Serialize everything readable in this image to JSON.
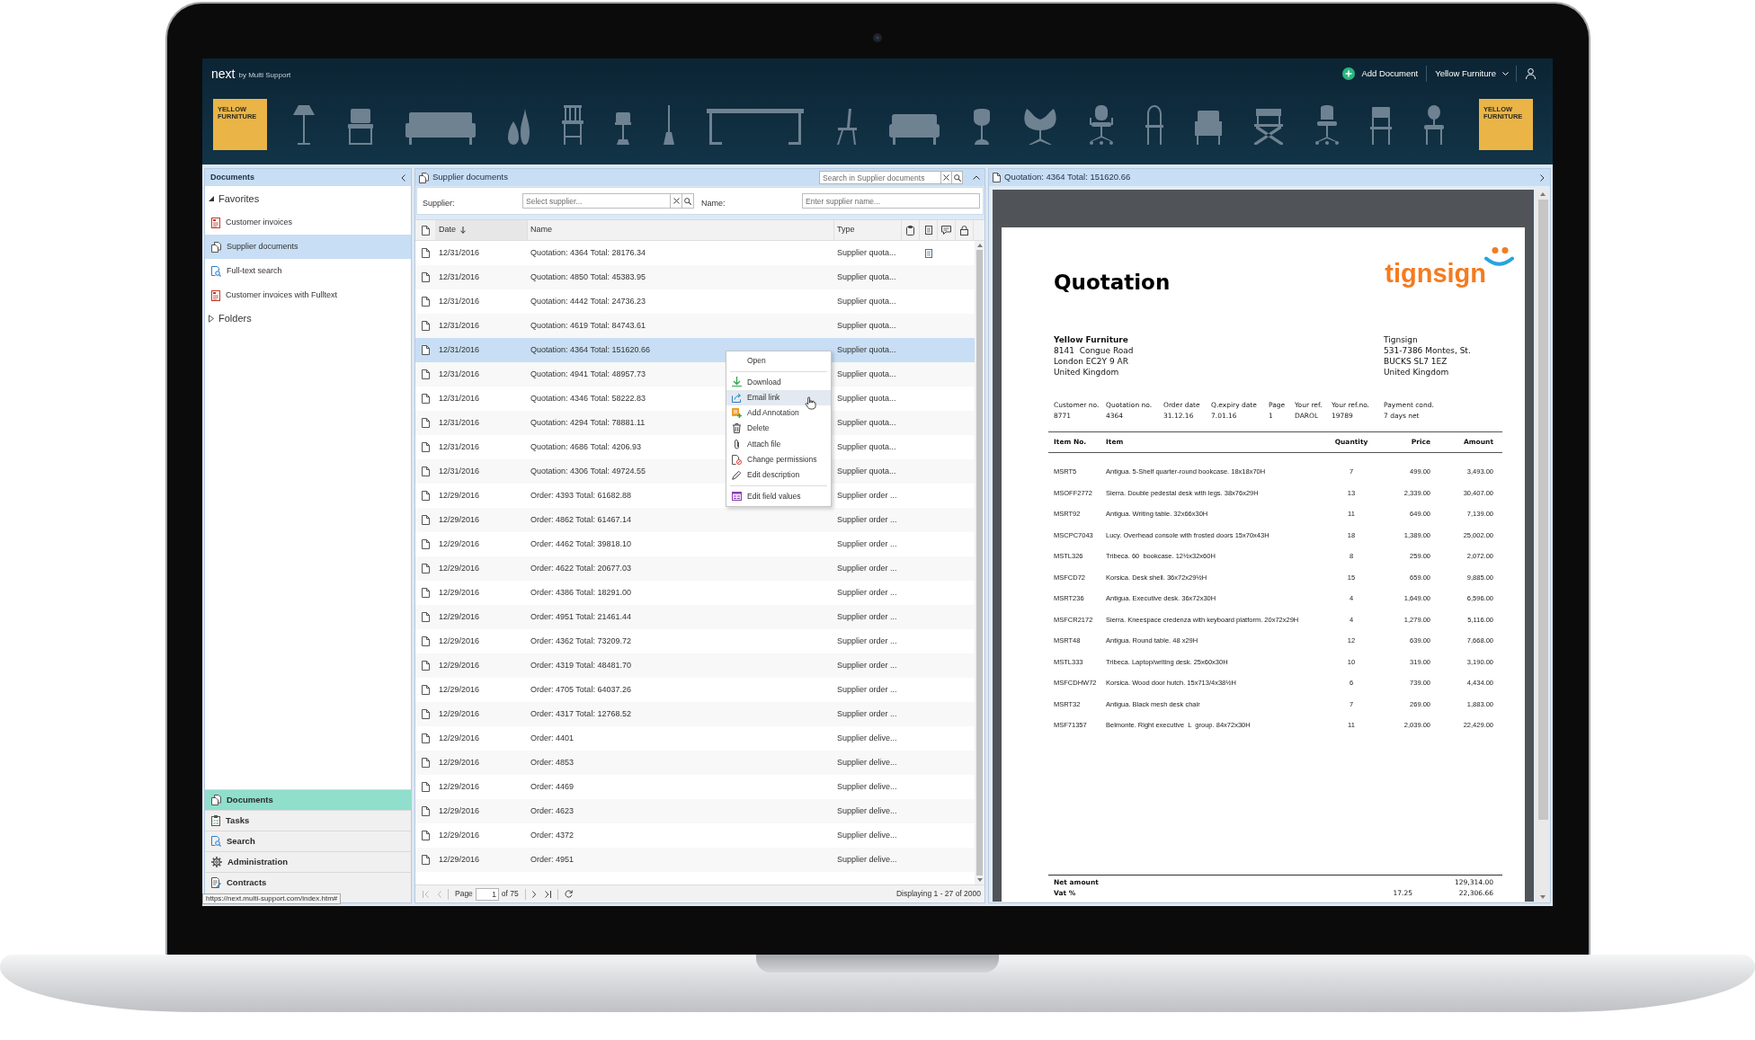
{
  "header": {
    "logo": "next",
    "logo_tagline": "by Multi Support",
    "add_document": "Add Document",
    "account_menu": "Yellow Furniture"
  },
  "banner": {
    "badges": [
      "YELLOW FURNITURE",
      "YELLOW FURNITURE"
    ]
  },
  "sidebar": {
    "title": "Documents",
    "tree": [
      {
        "label": "Favorites",
        "expanded": true,
        "children": [
          {
            "label": "Customer invoices",
            "kind": "invoice",
            "selected": false
          },
          {
            "label": "Supplier documents",
            "kind": "documents",
            "selected": true
          },
          {
            "label": "Full-text search",
            "kind": "search",
            "selected": false
          },
          {
            "label": "Customer invoices with Fulltext",
            "kind": "invoice",
            "selected": false
          }
        ]
      },
      {
        "label": "Folders",
        "expanded": false
      }
    ],
    "nav": [
      {
        "label": "Documents",
        "kind": "documents",
        "selected": true
      },
      {
        "label": "Tasks",
        "kind": "tasks",
        "selected": false
      },
      {
        "label": "Search",
        "kind": "search",
        "selected": false
      },
      {
        "label": "Administration",
        "kind": "settings",
        "selected": false
      },
      {
        "label": "Contracts",
        "kind": "contract",
        "selected": false
      }
    ]
  },
  "status_url": "https://next.multi-support.com/index.htm#",
  "documents": {
    "title": "Supplier documents",
    "search": {
      "placeholder": "Search in Supplier documents"
    },
    "filters": [
      {
        "label": "Supplier:",
        "placeholder": "Select supplier...",
        "kind": "lookup"
      },
      {
        "label": "Name:",
        "placeholder": "Enter supplier name...",
        "kind": "text"
      }
    ],
    "columns": [
      {
        "label": "Date",
        "sorted": true
      },
      {
        "label": "Name",
        "sorted": false
      },
      {
        "label": "Type",
        "sorted": false
      }
    ],
    "rows": [
      {
        "date": "12/31/2016",
        "name": "Quotation: 4364 Total: 28176.34",
        "type": "Supplier quota...",
        "selected": false,
        "linked_document": true
      },
      {
        "date": "12/31/2016",
        "name": "Quotation: 4850 Total: 45383.95",
        "type": "Supplier quota...",
        "selected": false,
        "linked_document": false
      },
      {
        "date": "12/31/2016",
        "name": "Quotation: 4442 Total: 24736.23",
        "type": "Supplier quota...",
        "selected": false,
        "linked_document": false
      },
      {
        "date": "12/31/2016",
        "name": "Quotation: 4619 Total: 84743.61",
        "type": "Supplier quota...",
        "selected": false,
        "linked_document": false
      },
      {
        "date": "12/31/2016",
        "name": "Quotation: 4364 Total: 151620.66",
        "type": "Supplier quota...",
        "selected": true,
        "linked_document": false
      },
      {
        "date": "12/31/2016",
        "name": "Quotation: 4941 Total: 48957.73",
        "type": "Supplier quota...",
        "selected": false,
        "linked_document": false
      },
      {
        "date": "12/31/2016",
        "name": "Quotation: 4346 Total: 58222.83",
        "type": "Supplier quota...",
        "selected": false,
        "linked_document": false
      },
      {
        "date": "12/31/2016",
        "name": "Quotation: 4294 Total: 78881.11",
        "type": "Supplier quota...",
        "selected": false,
        "linked_document": false
      },
      {
        "date": "12/31/2016",
        "name": "Quotation: 4686 Total: 4206.93",
        "type": "Supplier quota...",
        "selected": false,
        "linked_document": false
      },
      {
        "date": "12/31/2016",
        "name": "Quotation: 4306 Total: 49724.55",
        "type": "Supplier quota...",
        "selected": false,
        "linked_document": false
      },
      {
        "date": "12/29/2016",
        "name": "Order: 4393 Total: 61682.88",
        "type": "Supplier order ...",
        "selected": false,
        "linked_document": false
      },
      {
        "date": "12/29/2016",
        "name": "Order: 4862 Total: 61467.14",
        "type": "Supplier order ...",
        "selected": false,
        "linked_document": false
      },
      {
        "date": "12/29/2016",
        "name": "Order: 4462 Total: 39818.10",
        "type": "Supplier order ...",
        "selected": false,
        "linked_document": false
      },
      {
        "date": "12/29/2016",
        "name": "Order: 4622 Total: 20677.03",
        "type": "Supplier order ...",
        "selected": false,
        "linked_document": false
      },
      {
        "date": "12/29/2016",
        "name": "Order: 4386 Total: 18291.00",
        "type": "Supplier order ...",
        "selected": false,
        "linked_document": false
      },
      {
        "date": "12/29/2016",
        "name": "Order: 4951 Total: 21461.44",
        "type": "Supplier order ...",
        "selected": false,
        "linked_document": false
      },
      {
        "date": "12/29/2016",
        "name": "Order: 4362 Total: 73209.72",
        "type": "Supplier order ...",
        "selected": false,
        "linked_document": false
      },
      {
        "date": "12/29/2016",
        "name": "Order: 4319 Total: 48481.70",
        "type": "Supplier order ...",
        "selected": false,
        "linked_document": false
      },
      {
        "date": "12/29/2016",
        "name": "Order: 4705 Total: 64037.26",
        "type": "Supplier order ...",
        "selected": false,
        "linked_document": false
      },
      {
        "date": "12/29/2016",
        "name": "Order: 4317 Total: 12768.52",
        "type": "Supplier order ...",
        "selected": false,
        "linked_document": false
      },
      {
        "date": "12/29/2016",
        "name": "Order: 4401",
        "type": "Supplier delive...",
        "selected": false,
        "linked_document": false
      },
      {
        "date": "12/29/2016",
        "name": "Order: 4853",
        "type": "Supplier delive...",
        "selected": false,
        "linked_document": false
      },
      {
        "date": "12/29/2016",
        "name": "Order: 4469",
        "type": "Supplier delive...",
        "selected": false,
        "linked_document": false
      },
      {
        "date": "12/29/2016",
        "name": "Order: 4623",
        "type": "Supplier delive...",
        "selected": false,
        "linked_document": false
      },
      {
        "date": "12/29/2016",
        "name": "Order: 4372",
        "type": "Supplier delive...",
        "selected": false,
        "linked_document": false
      },
      {
        "date": "12/29/2016",
        "name": "Order: 4951",
        "type": "Supplier delive...",
        "selected": false,
        "linked_document": false
      }
    ],
    "pager": {
      "back_buttons": [
        {
          "kind": "first",
          "disabled": true
        },
        {
          "kind": "previous",
          "disabled": true
        }
      ],
      "page_label": "Page",
      "page": "1",
      "page_count": "of 75",
      "forward_buttons": [
        {
          "kind": "next",
          "disabled": false
        },
        {
          "kind": "last",
          "disabled": false
        }
      ],
      "summary": "Displaying 1 - 27 of 2000"
    }
  },
  "context_menu": {
    "groups": [
      [
        {
          "label": "Open",
          "kind": "open",
          "highlighted": false
        }
      ],
      [
        {
          "label": "Download",
          "kind": "download",
          "highlighted": false
        },
        {
          "label": "Email link",
          "kind": "email",
          "highlighted": true
        },
        {
          "label": "Add Annotation",
          "kind": "annotation",
          "highlighted": false
        },
        {
          "label": "Delete",
          "kind": "delete",
          "highlighted": false
        },
        {
          "label": "Attach file",
          "kind": "attach",
          "highlighted": false
        },
        {
          "label": "Change permissions",
          "kind": "permissions",
          "highlighted": false
        },
        {
          "label": "Edit description",
          "kind": "edit",
          "highlighted": false
        }
      ],
      [
        {
          "label": "Edit field values",
          "kind": "fields",
          "highlighted": false
        }
      ]
    ]
  },
  "preview": {
    "title": "Quotation: 4364 Total: 151620.66",
    "document": {
      "heading": "Quotation",
      "brand": "tignsign",
      "sender": [
        "Yellow Furniture",
        "8141  Congue Road",
        "London EC2Y 9 AR",
        "United Kingdom"
      ],
      "recipient": [
        "Tignsign",
        "531-7386 Montes, St.",
        "BUCKS SL7 1EZ",
        "United Kingdom"
      ],
      "meta": [
        {
          "label": "Customer no.",
          "value": "8771"
        },
        {
          "label": "Quotation no.",
          "value": "4364"
        },
        {
          "label": "Order date",
          "value": "31.12.16"
        },
        {
          "label": "Q.expiry date",
          "value": "7.01.16"
        },
        {
          "label": "Page",
          "value": "1"
        },
        {
          "label": "Your ref.",
          "value": "DAROL"
        },
        {
          "label": "Your ref.no.",
          "value": "19789"
        },
        {
          "label": "Payment cond.",
          "value": "7 days net"
        }
      ],
      "columns": [
        "Item No.",
        "Item",
        "Quantity",
        "Price",
        "Amount"
      ],
      "items": [
        {
          "number": "MSRT5",
          "item": "Antigua. 5-Shelf quarter-round bookcase. 18x18x70H",
          "quantity": "7",
          "price": "499.00",
          "amount": "3,493.00"
        },
        {
          "number": "MSOFF2772",
          "item": "Sierra. Double pedestal desk with legs. 38x76x29H",
          "quantity": "13",
          "price": "2,339.00",
          "amount": "30,407.00"
        },
        {
          "number": "MSRT92",
          "item": "Antigua. Writing table. 32x66x30H",
          "quantity": "11",
          "price": "649.00",
          "amount": "7,139.00"
        },
        {
          "number": "MSCPC7043",
          "item": "Lucy. Overhead console with frosted doors 15x70x43H",
          "quantity": "18",
          "price": "1,389.00",
          "amount": "25,002.00"
        },
        {
          "number": "MSTL326",
          "item": "Tribeca. 60  bookcase. 12½x32x60H",
          "quantity": "8",
          "price": "259.00",
          "amount": "2,072.00"
        },
        {
          "number": "MSFCD72",
          "item": "Korsica. Desk shell. 36x72x29½H",
          "quantity": "15",
          "price": "659.00",
          "amount": "9,885.00"
        },
        {
          "number": "MSRT236",
          "item": "Antigua. Executive desk. 36x72x30H",
          "quantity": "4",
          "price": "1,649.00",
          "amount": "6,596.00"
        },
        {
          "number": "MSFCR2172",
          "item": "Sierra. Kneespace credenza with keyboard platform. 20x72x29H",
          "quantity": "4",
          "price": "1,279.00",
          "amount": "5,116.00"
        },
        {
          "number": "MSRT48",
          "item": "Antigua. Round table. 48 x29H",
          "quantity": "12",
          "price": "639.00",
          "amount": "7,668.00"
        },
        {
          "number": "MSTL333",
          "item": "Tribeca. Laptop/writing desk. 25x60x30H",
          "quantity": "10",
          "price": "319.00",
          "amount": "3,190.00"
        },
        {
          "number": "MSFCDHW72",
          "item": "Korsica. Wood door hutch. 15x713/4x38½H",
          "quantity": "6",
          "price": "739.00",
          "amount": "4,434.00"
        },
        {
          "number": "MSRT32",
          "item": "Antigua. Black mesh desk chair",
          "quantity": "7",
          "price": "269.00",
          "amount": "1,883.00"
        },
        {
          "number": "MSF71357",
          "item": "Belmonte. Right executive  L  group. 84x72x30H",
          "quantity": "11",
          "price": "2,039.00",
          "amount": "22,429.00"
        }
      ],
      "totals": [
        {
          "label": "Net amount",
          "amount": "129,314.00"
        },
        {
          "label": "Vat %",
          "rate": "17.25",
          "amount": "22,306.66"
        }
      ]
    }
  }
}
